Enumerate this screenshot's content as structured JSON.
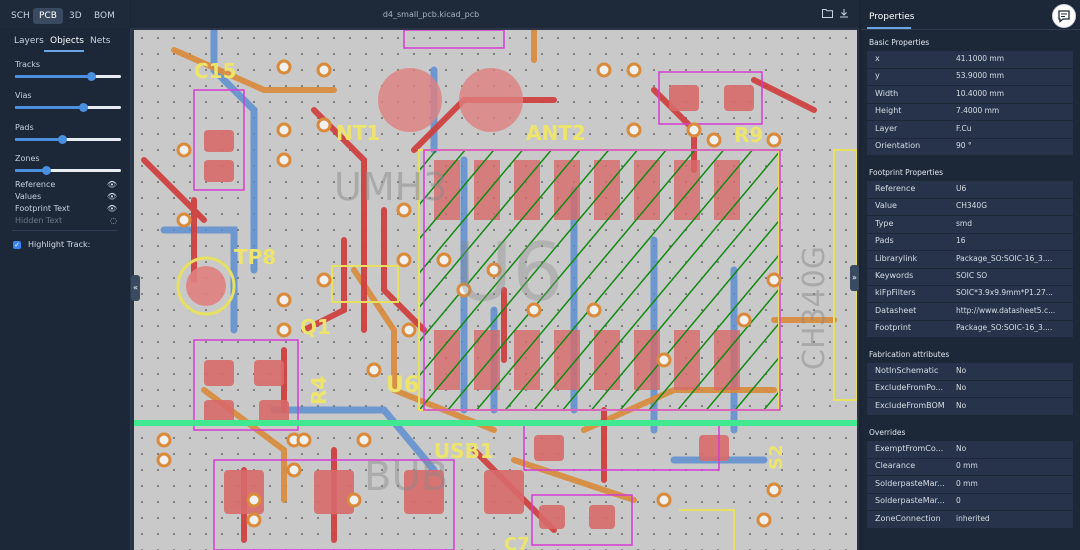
{
  "view_tabs": [
    "SCH",
    "PCB",
    "3D",
    "BOM"
  ],
  "panel_tabs": [
    "Layers",
    "Objects",
    "Nets"
  ],
  "sliders": [
    {
      "label": "Tracks",
      "value": 0.72
    },
    {
      "label": "Vias",
      "value": 0.65
    },
    {
      "label": "Pads",
      "value": 0.45
    },
    {
      "label": "Zones",
      "value": 0.3
    }
  ],
  "visibility": [
    {
      "label": "Reference",
      "dim": false
    },
    {
      "label": "Values",
      "dim": false
    },
    {
      "label": "Footprint Text",
      "dim": false
    },
    {
      "label": "Hidden Text",
      "dim": true
    }
  ],
  "highlight_track": {
    "label": "Highlight Track:",
    "checked": true
  },
  "canvas": {
    "filename": "d4_small_pcb.kicad_pcb"
  },
  "pcb_labels": [
    "C15",
    "NT1",
    "ANT2",
    "R9",
    "TP8",
    "Q1",
    "R4",
    "U6",
    "USB1",
    "S2",
    "C7",
    "CH340G"
  ],
  "properties": {
    "title": "Properties",
    "sections": [
      {
        "title": "Basic Properties",
        "rows": [
          [
            "x",
            "41.1000 mm"
          ],
          [
            "y",
            "53.9000 mm"
          ],
          [
            "Width",
            "10.4000 mm"
          ],
          [
            "Height",
            "7.4000 mm"
          ],
          [
            "Layer",
            "F.Cu"
          ],
          [
            "Orientation",
            "90 °"
          ]
        ]
      },
      {
        "title": "Footprint Properties",
        "rows": [
          [
            "Reference",
            "U6"
          ],
          [
            "Value",
            "CH340G"
          ],
          [
            "Type",
            "smd"
          ],
          [
            "Pads",
            "16"
          ],
          [
            "Librarylink",
            "Package_SO:SOIC-16_3...."
          ],
          [
            "Keywords",
            "SOIC SO"
          ],
          [
            "kiFpFilters",
            "SOIC*3.9x9.9mm*P1.27..."
          ],
          [
            "Datasheet",
            "http://www.datasheet5.c..."
          ],
          [
            "Footprint",
            "Package_SO:SOIC-16_3...."
          ]
        ]
      },
      {
        "title": "Fabrication attributes",
        "rows": [
          [
            "NotInSchematic",
            "No"
          ],
          [
            "ExcludeFromPo...",
            "No"
          ],
          [
            "ExcludeFromBOM",
            "No"
          ]
        ]
      },
      {
        "title": "Overrides",
        "rows": [
          [
            "ExemptFromCo...",
            "No"
          ],
          [
            "Clearance",
            "0 mm"
          ],
          [
            "SolderpasteMar...",
            "0 mm"
          ],
          [
            "SolderpasteMar...",
            "0"
          ],
          [
            "ZoneConnection",
            "inherited"
          ]
        ]
      }
    ]
  }
}
